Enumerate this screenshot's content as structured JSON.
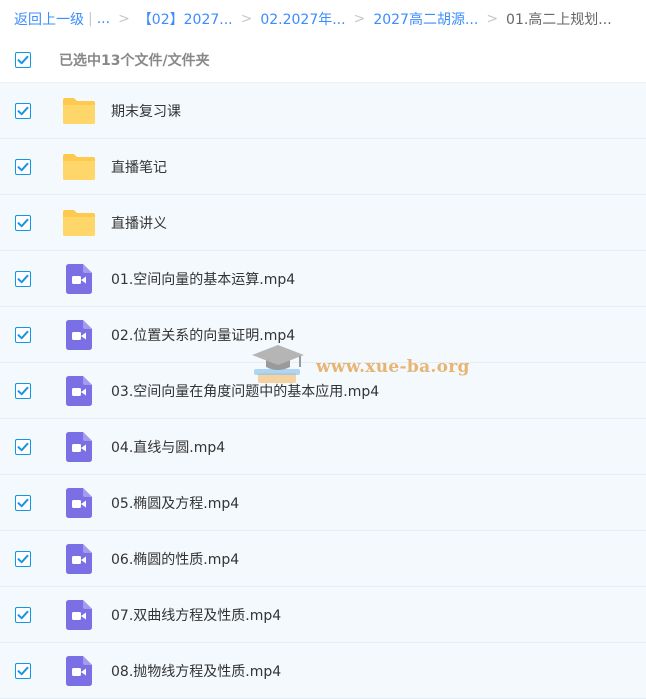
{
  "breadcrumb": {
    "back": "返回上一级",
    "ellipsis": "...",
    "crumbs": [
      "【02】2027...",
      "02.2027年...",
      "2027高二胡源..."
    ],
    "current": "01.高二上规划..."
  },
  "header": {
    "selected_label": "已选中13个文件/文件夹",
    "checked": true
  },
  "files": [
    {
      "name": "期末复习课",
      "kind": "folder",
      "icon": "folder-icon",
      "checked": true
    },
    {
      "name": "直播笔记",
      "kind": "folder",
      "icon": "folder-icon",
      "checked": true
    },
    {
      "name": "直播讲义",
      "kind": "folder",
      "icon": "folder-icon",
      "checked": true
    },
    {
      "name": "01.空间向量的基本运算.mp4",
      "kind": "video",
      "icon": "video-file-icon",
      "checked": true
    },
    {
      "name": "02.位置关系的向量证明.mp4",
      "kind": "video",
      "icon": "video-file-icon",
      "checked": true
    },
    {
      "name": "03.空间向量在角度问题中的基本应用.mp4",
      "kind": "video",
      "icon": "video-file-icon",
      "checked": true
    },
    {
      "name": "04.直线与圆.mp4",
      "kind": "video",
      "icon": "video-file-icon",
      "checked": true
    },
    {
      "name": "05.椭圆及方程.mp4",
      "kind": "video",
      "icon": "video-file-icon",
      "checked": true
    },
    {
      "name": "06.椭圆的性质.mp4",
      "kind": "video",
      "icon": "video-file-icon",
      "checked": true
    },
    {
      "name": "07.双曲线方程及性质.mp4",
      "kind": "video",
      "icon": "video-file-icon",
      "checked": true
    },
    {
      "name": "08.抛物线方程及性质.mp4",
      "kind": "video",
      "icon": "video-file-icon",
      "checked": true
    }
  ],
  "watermark": {
    "text": "www.xue-ba.org",
    "icon": "graduation-cap-logo"
  },
  "colors": {
    "accent": "#3b8cff",
    "checkbox": "#1296e6",
    "row_bg": "#f4f9fd",
    "folder": "#ffc94d",
    "video": "#7b6fe6",
    "watermark": "#e8a85a"
  }
}
